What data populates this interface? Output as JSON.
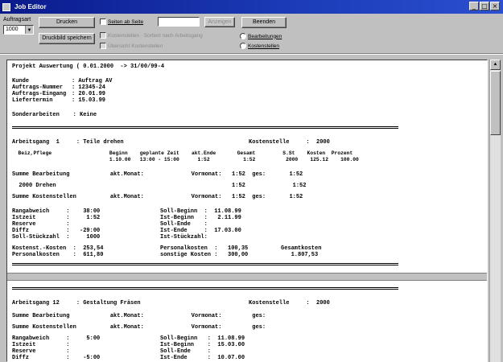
{
  "window": {
    "title": "Job Editor",
    "controls": [
      "_",
      "□",
      "×"
    ]
  },
  "toolbar": {
    "device_label": "Auftragsart",
    "device_select": "1000",
    "print_button": "Drucken",
    "export_button": "Druckbild speichern",
    "page_checkbox": "Seiten ab Seite",
    "page_input": "",
    "page_button": "Anzeigen",
    "opt_checkbox_1": "Kostenstellen · Sortiert nach Arbeitsgang",
    "opt_checkbox_2": "Übersicht Kostenstellen",
    "close_button": "Beenden",
    "radio_1": "Bearbeitungen",
    "radio_2": "Kostenstellen"
  },
  "report": {
    "header_line": "Projekt Auswertung ( 0.01.2000  -> 31/00/99-4",
    "fields": [
      {
        "label": "Kunde",
        "value": ": Auftrag AV"
      },
      {
        "label": "Auftrags-Nummer",
        "value": ": 12345-24"
      },
      {
        "label": "Auftrags-Eingang",
        "value": ": 20.01.99"
      },
      {
        "label": "Liefertermin",
        "value": ": 15.03.99"
      }
    ],
    "extra_line": "Sonderarbeiten    : Keine",
    "op1": {
      "title": "Arbeitsgang  1     : Teile drehen",
      "cost_center": "Kostenstelle     :  2000",
      "col_headers": "  Beiz,Pflege                   Beginn    geplante Zeit    akt.Ende       Gesamt         S.St    Kosten  Prozent",
      "col_values": "                                1.10.00   13:00 - 15:00      1:52           1:52          2000    125.12    100.00",
      "row_a": "Summe Bearbeitung            akt.Monat:              Vormonat:   1:52  ges:       1:52",
      "row_b": "  2000 Drehen                                                    1:52              1:52",
      "row_c": "Summe Kostenstellen          akt.Monat:              Vormonat:   1:52  ges:       1:52",
      "detail_left": "Rangabweich     :    38:00\nIstzeit         :     1:52\nReserve         :\nDiffz           :   -29:00\nSoll-Stückzahl  :     1000",
      "detail_mid": "Soll-Beginn  :  11.08.99\nIst-Beginn   :   2.11.99\nSoll-Ende    :\nIst-Ende     :  17.03.00\nIst-Stückzahl:",
      "cost_left": "Kostenst.-Kosten  :  253,54\nPersonalkosten    :  611,80",
      "cost_mid": "Personalkosten  :   100,35\nsonstige Kosten :   300,00",
      "cost_right": "Gesamtkosten\n   1.807,53"
    },
    "op2": {
      "title": "Arbeitsgang 12     : Gestaltung Fräsen",
      "cost_center": "Kostenstelle     :  2000",
      "row_a": "Summe Bearbeitung            akt.Monat:              Vormonat:         ges:",
      "row_c": "Summe Kostenstellen          akt.Monat:              Vormonat:         ges:",
      "detail_left": "Rangabweich     :     5:00\nIstzeit         :\nReserve         :\nDiffz           :    -5:00\nSoll-Stückzahl  :",
      "detail_mid": "Soll-Beginn   :  11.08.99\nIst-Beginn    :  15.03.00\nSoll-Ende     :\nIst-Ende      :  10.07.00\nIst-Stückzahl :"
    }
  }
}
